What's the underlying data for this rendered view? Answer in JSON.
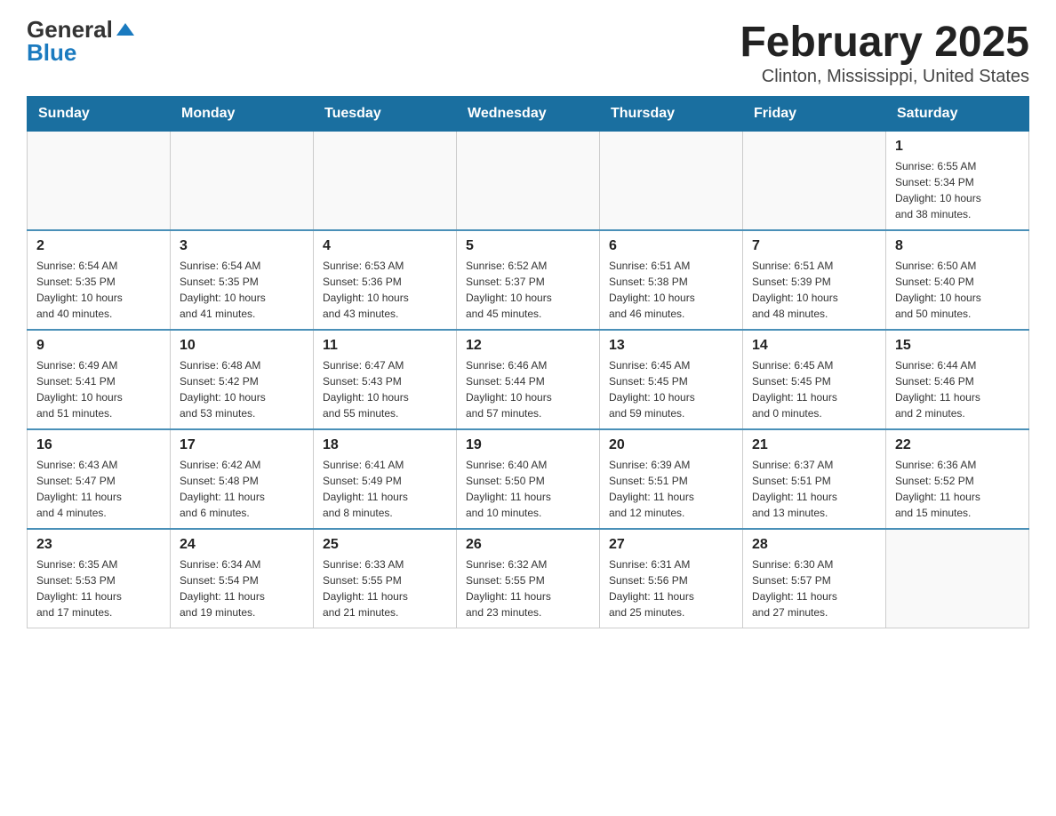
{
  "header": {
    "logo_general": "General",
    "logo_blue": "Blue",
    "month_title": "February 2025",
    "location": "Clinton, Mississippi, United States"
  },
  "weekdays": [
    "Sunday",
    "Monday",
    "Tuesday",
    "Wednesday",
    "Thursday",
    "Friday",
    "Saturday"
  ],
  "weeks": [
    [
      {
        "day": "",
        "info": ""
      },
      {
        "day": "",
        "info": ""
      },
      {
        "day": "",
        "info": ""
      },
      {
        "day": "",
        "info": ""
      },
      {
        "day": "",
        "info": ""
      },
      {
        "day": "",
        "info": ""
      },
      {
        "day": "1",
        "info": "Sunrise: 6:55 AM\nSunset: 5:34 PM\nDaylight: 10 hours\nand 38 minutes."
      }
    ],
    [
      {
        "day": "2",
        "info": "Sunrise: 6:54 AM\nSunset: 5:35 PM\nDaylight: 10 hours\nand 40 minutes."
      },
      {
        "day": "3",
        "info": "Sunrise: 6:54 AM\nSunset: 5:35 PM\nDaylight: 10 hours\nand 41 minutes."
      },
      {
        "day": "4",
        "info": "Sunrise: 6:53 AM\nSunset: 5:36 PM\nDaylight: 10 hours\nand 43 minutes."
      },
      {
        "day": "5",
        "info": "Sunrise: 6:52 AM\nSunset: 5:37 PM\nDaylight: 10 hours\nand 45 minutes."
      },
      {
        "day": "6",
        "info": "Sunrise: 6:51 AM\nSunset: 5:38 PM\nDaylight: 10 hours\nand 46 minutes."
      },
      {
        "day": "7",
        "info": "Sunrise: 6:51 AM\nSunset: 5:39 PM\nDaylight: 10 hours\nand 48 minutes."
      },
      {
        "day": "8",
        "info": "Sunrise: 6:50 AM\nSunset: 5:40 PM\nDaylight: 10 hours\nand 50 minutes."
      }
    ],
    [
      {
        "day": "9",
        "info": "Sunrise: 6:49 AM\nSunset: 5:41 PM\nDaylight: 10 hours\nand 51 minutes."
      },
      {
        "day": "10",
        "info": "Sunrise: 6:48 AM\nSunset: 5:42 PM\nDaylight: 10 hours\nand 53 minutes."
      },
      {
        "day": "11",
        "info": "Sunrise: 6:47 AM\nSunset: 5:43 PM\nDaylight: 10 hours\nand 55 minutes."
      },
      {
        "day": "12",
        "info": "Sunrise: 6:46 AM\nSunset: 5:44 PM\nDaylight: 10 hours\nand 57 minutes."
      },
      {
        "day": "13",
        "info": "Sunrise: 6:45 AM\nSunset: 5:45 PM\nDaylight: 10 hours\nand 59 minutes."
      },
      {
        "day": "14",
        "info": "Sunrise: 6:45 AM\nSunset: 5:45 PM\nDaylight: 11 hours\nand 0 minutes."
      },
      {
        "day": "15",
        "info": "Sunrise: 6:44 AM\nSunset: 5:46 PM\nDaylight: 11 hours\nand 2 minutes."
      }
    ],
    [
      {
        "day": "16",
        "info": "Sunrise: 6:43 AM\nSunset: 5:47 PM\nDaylight: 11 hours\nand 4 minutes."
      },
      {
        "day": "17",
        "info": "Sunrise: 6:42 AM\nSunset: 5:48 PM\nDaylight: 11 hours\nand 6 minutes."
      },
      {
        "day": "18",
        "info": "Sunrise: 6:41 AM\nSunset: 5:49 PM\nDaylight: 11 hours\nand 8 minutes."
      },
      {
        "day": "19",
        "info": "Sunrise: 6:40 AM\nSunset: 5:50 PM\nDaylight: 11 hours\nand 10 minutes."
      },
      {
        "day": "20",
        "info": "Sunrise: 6:39 AM\nSunset: 5:51 PM\nDaylight: 11 hours\nand 12 minutes."
      },
      {
        "day": "21",
        "info": "Sunrise: 6:37 AM\nSunset: 5:51 PM\nDaylight: 11 hours\nand 13 minutes."
      },
      {
        "day": "22",
        "info": "Sunrise: 6:36 AM\nSunset: 5:52 PM\nDaylight: 11 hours\nand 15 minutes."
      }
    ],
    [
      {
        "day": "23",
        "info": "Sunrise: 6:35 AM\nSunset: 5:53 PM\nDaylight: 11 hours\nand 17 minutes."
      },
      {
        "day": "24",
        "info": "Sunrise: 6:34 AM\nSunset: 5:54 PM\nDaylight: 11 hours\nand 19 minutes."
      },
      {
        "day": "25",
        "info": "Sunrise: 6:33 AM\nSunset: 5:55 PM\nDaylight: 11 hours\nand 21 minutes."
      },
      {
        "day": "26",
        "info": "Sunrise: 6:32 AM\nSunset: 5:55 PM\nDaylight: 11 hours\nand 23 minutes."
      },
      {
        "day": "27",
        "info": "Sunrise: 6:31 AM\nSunset: 5:56 PM\nDaylight: 11 hours\nand 25 minutes."
      },
      {
        "day": "28",
        "info": "Sunrise: 6:30 AM\nSunset: 5:57 PM\nDaylight: 11 hours\nand 27 minutes."
      },
      {
        "day": "",
        "info": ""
      }
    ]
  ]
}
